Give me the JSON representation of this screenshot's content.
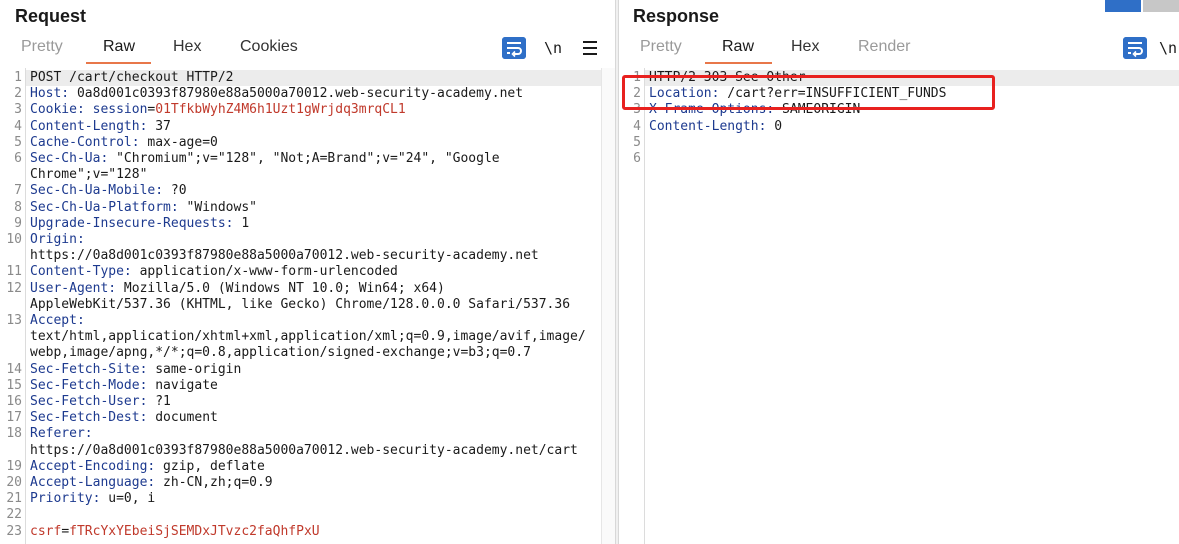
{
  "request": {
    "title": "Request",
    "tabs": [
      "Pretty",
      "Raw",
      "Hex",
      "Cookies"
    ],
    "active_tab": "Raw",
    "tools": {
      "wrap_icon": "wrap-lines-icon",
      "newline_label": "\\n",
      "menu_icon": "hamburger-menu-icon"
    },
    "lines": [
      {
        "n": "1",
        "parts": [
          {
            "t": "POST /cart/checkout HTTP/2"
          }
        ]
      },
      {
        "n": "2",
        "parts": [
          {
            "t": "Host:",
            "k": true
          },
          {
            "t": " 0a8d001c0393f87980e88a5000a70012.web-security-academy.net"
          }
        ]
      },
      {
        "n": "3",
        "parts": [
          {
            "t": "Cookie:",
            "k": true
          },
          {
            "t": " session",
            "k": true
          },
          {
            "t": "="
          },
          {
            "t": "01TfkbWyhZ4M6h1Uzt1gWrjdq3mrqCL1",
            "r": true
          }
        ]
      },
      {
        "n": "4",
        "parts": [
          {
            "t": "Content-Length:",
            "k": true
          },
          {
            "t": " 37"
          }
        ]
      },
      {
        "n": "5",
        "parts": [
          {
            "t": "Cache-Control:",
            "k": true
          },
          {
            "t": " max-age=0"
          }
        ]
      },
      {
        "n": "6",
        "parts": [
          {
            "t": "Sec-Ch-Ua:",
            "k": true
          },
          {
            "t": " \"Chromium\";v=\"128\", \"Not;A=Brand\";v=\"24\", \"Google"
          }
        ]
      },
      {
        "n": "",
        "parts": [
          {
            "t": "Chrome\";v=\"128\""
          }
        ]
      },
      {
        "n": "7",
        "parts": [
          {
            "t": "Sec-Ch-Ua-Mobile:",
            "k": true
          },
          {
            "t": " ?0"
          }
        ]
      },
      {
        "n": "8",
        "parts": [
          {
            "t": "Sec-Ch-Ua-Platform:",
            "k": true
          },
          {
            "t": " \"Windows\""
          }
        ]
      },
      {
        "n": "9",
        "parts": [
          {
            "t": "Upgrade-Insecure-Requests:",
            "k": true
          },
          {
            "t": " 1"
          }
        ]
      },
      {
        "n": "10",
        "parts": [
          {
            "t": "Origin:",
            "k": true
          }
        ]
      },
      {
        "n": "",
        "parts": [
          {
            "t": "https://0a8d001c0393f87980e88a5000a70012.web-security-academy.net"
          }
        ]
      },
      {
        "n": "11",
        "parts": [
          {
            "t": "Content-Type:",
            "k": true
          },
          {
            "t": " application/x-www-form-urlencoded"
          }
        ]
      },
      {
        "n": "12",
        "parts": [
          {
            "t": "User-Agent:",
            "k": true
          },
          {
            "t": " Mozilla/5.0 (Windows NT 10.0; Win64; x64)"
          }
        ]
      },
      {
        "n": "",
        "parts": [
          {
            "t": "AppleWebKit/537.36 (KHTML, like Gecko) Chrome/128.0.0.0 Safari/537.36"
          }
        ]
      },
      {
        "n": "13",
        "parts": [
          {
            "t": "Accept:",
            "k": true
          }
        ]
      },
      {
        "n": "",
        "parts": [
          {
            "t": "text/html,application/xhtml+xml,application/xml;q=0.9,image/avif,image/"
          }
        ]
      },
      {
        "n": "",
        "parts": [
          {
            "t": "webp,image/apng,*/*;q=0.8,application/signed-exchange;v=b3;q=0.7"
          }
        ]
      },
      {
        "n": "14",
        "parts": [
          {
            "t": "Sec-Fetch-Site:",
            "k": true
          },
          {
            "t": " same-origin"
          }
        ]
      },
      {
        "n": "15",
        "parts": [
          {
            "t": "Sec-Fetch-Mode:",
            "k": true
          },
          {
            "t": " navigate"
          }
        ]
      },
      {
        "n": "16",
        "parts": [
          {
            "t": "Sec-Fetch-User:",
            "k": true
          },
          {
            "t": " ?1"
          }
        ]
      },
      {
        "n": "17",
        "parts": [
          {
            "t": "Sec-Fetch-Dest:",
            "k": true
          },
          {
            "t": " document"
          }
        ]
      },
      {
        "n": "18",
        "parts": [
          {
            "t": "Referer:",
            "k": true
          }
        ]
      },
      {
        "n": "",
        "parts": [
          {
            "t": "https://0a8d001c0393f87980e88a5000a70012.web-security-academy.net/cart"
          }
        ]
      },
      {
        "n": "19",
        "parts": [
          {
            "t": "Accept-Encoding:",
            "k": true
          },
          {
            "t": " gzip, deflate"
          }
        ]
      },
      {
        "n": "20",
        "parts": [
          {
            "t": "Accept-Language:",
            "k": true
          },
          {
            "t": " zh-CN,zh;q=0.9"
          }
        ]
      },
      {
        "n": "21",
        "parts": [
          {
            "t": "Priority:",
            "k": true
          },
          {
            "t": " u=0, i"
          }
        ]
      },
      {
        "n": "22",
        "parts": []
      },
      {
        "n": "23",
        "parts": [
          {
            "t": "csrf",
            "r": true
          },
          {
            "t": "="
          },
          {
            "t": "fTRcYxYEbeiSjSEMDxJTvzc2faQhfPxU",
            "r": true
          }
        ]
      }
    ]
  },
  "response": {
    "title": "Response",
    "tabs": [
      "Pretty",
      "Raw",
      "Hex",
      "Render"
    ],
    "active_tab": "Raw",
    "tools": {
      "wrap_icon": "wrap-lines-icon",
      "newline_label": "\\n"
    },
    "lines": [
      {
        "n": "1",
        "parts": [
          {
            "t": "HTTP/2 303 See Other"
          }
        ]
      },
      {
        "n": "2",
        "parts": [
          {
            "t": "Location:",
            "k": true
          },
          {
            "t": " /cart?err=INSUFFICIENT_FUNDS"
          }
        ]
      },
      {
        "n": "3",
        "parts": [
          {
            "t": "X-Frame-Options:",
            "k": true
          },
          {
            "t": " SAMEORIGIN"
          }
        ]
      },
      {
        "n": "4",
        "parts": [
          {
            "t": "Content-Length:",
            "k": true
          },
          {
            "t": " 0"
          }
        ]
      },
      {
        "n": "5",
        "parts": []
      },
      {
        "n": "6",
        "parts": []
      }
    ]
  },
  "colors": {
    "accent": "#e8774a",
    "highlight_box": "#e8211f",
    "header_key": "#1d3a8f",
    "value_red": "#c0392b",
    "tool_blue": "#2f6fc7"
  }
}
